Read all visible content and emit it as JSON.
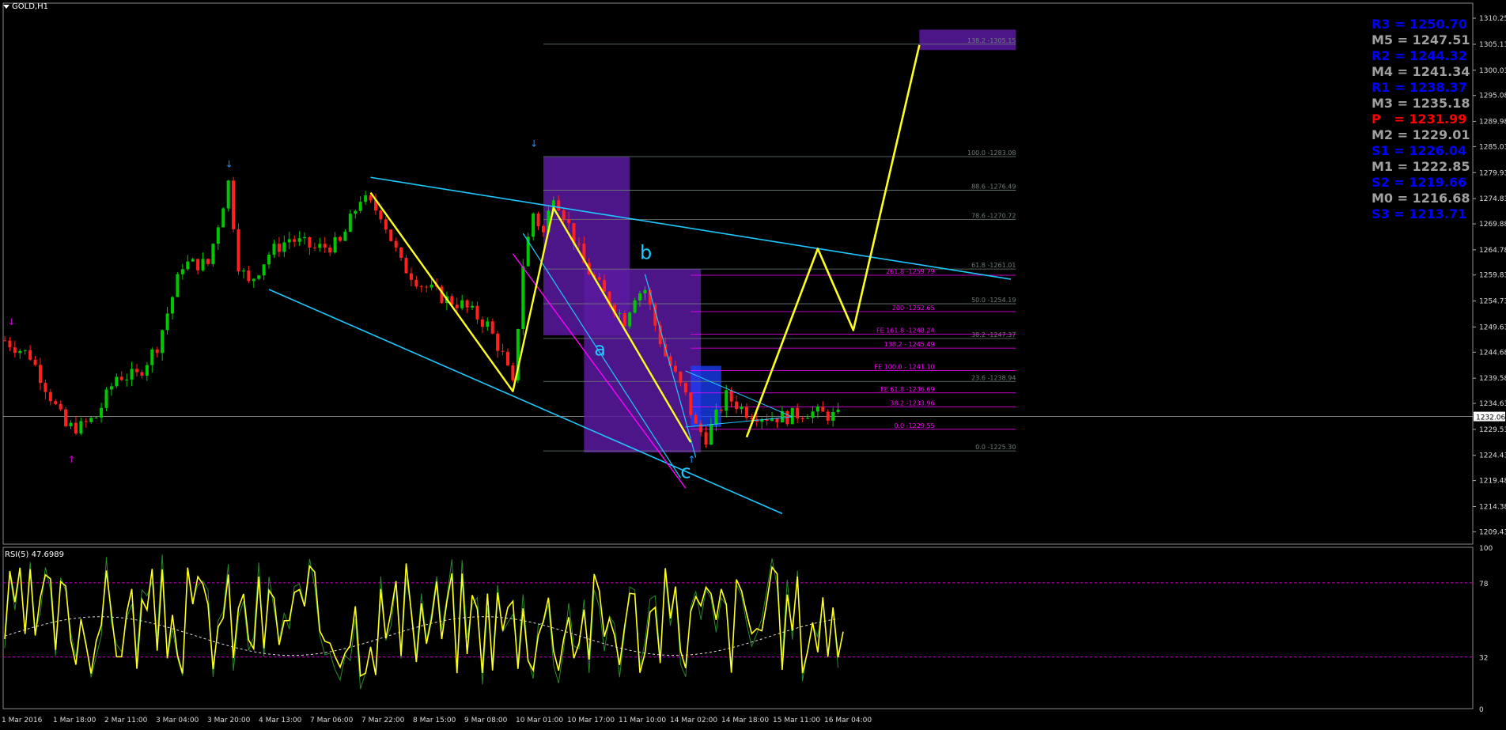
{
  "window": {
    "title": "GOLD,H1"
  },
  "colors": {
    "background": "#000000",
    "grid": "#3a3a3a",
    "bull": "#00c800",
    "bear": "#ff2020",
    "pattern": "#ffff1e",
    "trendline": "#1ec8ff",
    "fib": "#ff00ff",
    "fib_gray": "#6f7f7a",
    "box": "#5a1aa0",
    "pivot_blue": "#0000ff",
    "pivot_gray": "#a0a0a0",
    "pivot_red": "#ff0000"
  },
  "pivots": [
    {
      "label": "R3 = 1250.70",
      "color": "#0000ff"
    },
    {
      "label": "M5 = 1247.51",
      "color": "#a0a0a0"
    },
    {
      "label": "R2 = 1244.32",
      "color": "#0000ff"
    },
    {
      "label": "M4 = 1241.34",
      "color": "#a0a0a0"
    },
    {
      "label": "R1 = 1238.37",
      "color": "#0000ff"
    },
    {
      "label": "M3 = 1235.18",
      "color": "#a0a0a0"
    },
    {
      "label": "P   = 1231.99",
      "color": "#ff0000"
    },
    {
      "label": "M2 = 1229.01",
      "color": "#a0a0a0"
    },
    {
      "label": "S1 = 1226.04",
      "color": "#0000ff"
    },
    {
      "label": "M1 = 1222.85",
      "color": "#a0a0a0"
    },
    {
      "label": "S2 = 1219.66",
      "color": "#0000ff"
    },
    {
      "label": "M0 = 1216.68",
      "color": "#a0a0a0"
    },
    {
      "label": "S3 = 1213.71",
      "color": "#0000ff"
    }
  ],
  "chart_data": {
    "type": "candlestick",
    "title": "GOLD,H1",
    "current_price": "1232.06",
    "ylim": [
      1207.0,
      1313.2
    ],
    "y_ticks": [
      "1310.25",
      "1305.13",
      "1300.03",
      "1295.08",
      "1289.98",
      "1285.03",
      "1279.93",
      "1274.83",
      "1269.88",
      "1264.78",
      "1259.83",
      "1254.73",
      "1249.63",
      "1244.68",
      "1239.58",
      "1234.63",
      "1229.53",
      "1224.43",
      "1219.48",
      "1214.38",
      "1209.43"
    ],
    "x_labels": [
      "1 Mar 2016",
      "1 Mar 18:00",
      "2 Mar 11:00",
      "3 Mar 04:00",
      "3 Mar 20:00",
      "4 Mar 13:00",
      "7 Mar 06:00",
      "7 Mar 22:00",
      "8 Mar 15:00",
      "9 Mar 08:00",
      "10 Mar 01:00",
      "10 Mar 17:00",
      "11 Mar 10:00",
      "14 Mar 02:00",
      "14 Mar 18:00",
      "15 Mar 11:00",
      "16 Mar 04:00"
    ],
    "candles_count": 165,
    "price_path": [
      [
        0,
        1247
      ],
      [
        5,
        1244
      ],
      [
        9,
        1236
      ],
      [
        12,
        1230
      ],
      [
        15,
        1230
      ],
      [
        18,
        1232
      ],
      [
        22,
        1240
      ],
      [
        26,
        1240
      ],
      [
        30,
        1246
      ],
      [
        35,
        1262
      ],
      [
        40,
        1262
      ],
      [
        44,
        1278
      ],
      [
        46,
        1262
      ],
      [
        48,
        1258
      ],
      [
        52,
        1264
      ],
      [
        56,
        1267
      ],
      [
        61,
        1265
      ],
      [
        66,
        1266
      ],
      [
        70,
        1275
      ],
      [
        74,
        1272
      ],
      [
        78,
        1262
      ],
      [
        82,
        1258
      ],
      [
        87,
        1255
      ],
      [
        90,
        1254
      ],
      [
        95,
        1250
      ],
      [
        98,
        1244
      ],
      [
        100,
        1238
      ],
      [
        102,
        1262
      ],
      [
        104,
        1272
      ],
      [
        106,
        1268
      ],
      [
        108,
        1276
      ],
      [
        110,
        1272
      ],
      [
        114,
        1262
      ],
      [
        118,
        1256
      ],
      [
        122,
        1251
      ],
      [
        124,
        1256
      ],
      [
        126,
        1257
      ],
      [
        128,
        1250
      ],
      [
        130,
        1244
      ],
      [
        132,
        1240
      ],
      [
        134,
        1236
      ],
      [
        136,
        1230
      ],
      [
        138,
        1228
      ],
      [
        140,
        1232
      ],
      [
        142,
        1236
      ],
      [
        146,
        1233
      ],
      [
        150,
        1232
      ],
      [
        154,
        1232
      ],
      [
        158,
        1233
      ],
      [
        164,
        1232
      ]
    ],
    "fib_levels_gray": [
      {
        "label": "138.2 -1305.15",
        "price": 1305.15
      },
      {
        "label": "100.0 -1283.08",
        "price": 1283.08
      },
      {
        "label": "88.6 -1276.49",
        "price": 1276.49
      },
      {
        "label": "78.6 -1270.72",
        "price": 1270.72
      },
      {
        "label": "61.8 -1261.01",
        "price": 1261.01
      },
      {
        "label": "50.0 -1254.19",
        "price": 1254.19
      },
      {
        "label": "38.2 -1247.37",
        "price": 1247.37
      },
      {
        "label": "23.6 -1238.94",
        "price": 1238.94
      },
      {
        "label": "0.0 -1225.30",
        "price": 1225.3
      }
    ],
    "fib_levels_magenta": [
      {
        "label": "261.8 -1259.79",
        "price": 1259.79
      },
      {
        "label": "200 -1252.65",
        "price": 1252.65
      },
      {
        "label": "FE 161.8 -1248.24",
        "price": 1248.24
      },
      {
        "label": "138.2 - 1245.49",
        "price": 1245.49
      },
      {
        "label": "FE 100.0 - 1241.10",
        "price": 1241.1
      },
      {
        "label": "FE 61.8 -1236.69",
        "price": 1236.69
      },
      {
        "label": "38.2 -1233.96",
        "price": 1233.96
      },
      {
        "label": "0.0 -1229.55",
        "price": 1229.55
      }
    ],
    "wave_labels": [
      {
        "text": "a",
        "price": 1244.0
      },
      {
        "text": "b",
        "price": 1263.0
      },
      {
        "text": "c",
        "price": 1220.0
      }
    ],
    "projection_path": [
      [
        146,
        1228
      ],
      [
        160,
        1265
      ],
      [
        167,
        1249
      ],
      [
        180,
        1305
      ]
    ],
    "zigzag_path": [
      [
        72,
        1276
      ],
      [
        100,
        1237
      ],
      [
        108,
        1273
      ],
      [
        135,
        1227
      ]
    ],
    "rsi": {
      "label": "RSI(5) 47.6989",
      "ylim": [
        0,
        100
      ],
      "ticks": [
        "100",
        "78",
        "32",
        "0"
      ],
      "upper": 78,
      "lower": 32,
      "last": 47.6989
    }
  }
}
